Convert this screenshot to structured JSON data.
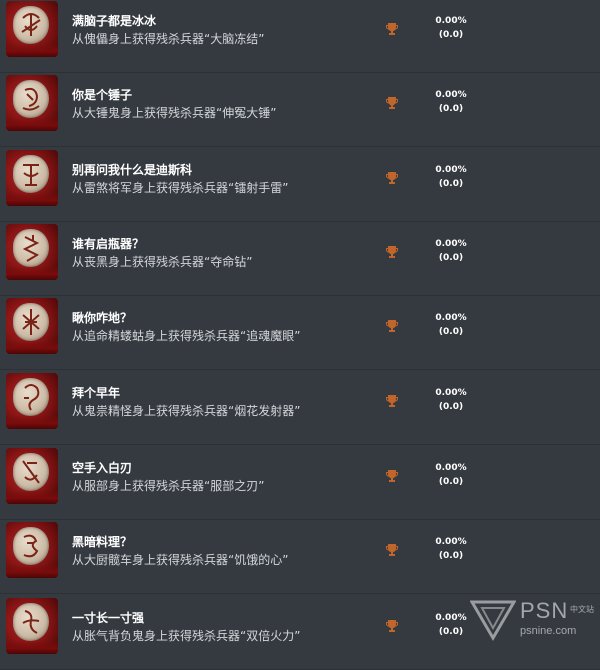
{
  "trophies": [
    {
      "title": "满脑子都是冰冰",
      "description": "从傀儡身上获得残杀兵器“大脑冻结”",
      "percent": "0.00%",
      "count": "(0.0)",
      "icon": "trophy-bronze-icon"
    },
    {
      "title": "你是个锤子",
      "description": "从大锤鬼身上获得残杀兵器“伸冤大锤”",
      "percent": "0.00%",
      "count": "(0.0)",
      "icon": "trophy-bronze-icon"
    },
    {
      "title": "别再问我什么是迪斯科",
      "description": "从雷煞将军身上获得残杀兵器“镭射手雷”",
      "percent": "0.00%",
      "count": "(0.0)",
      "icon": "trophy-bronze-icon"
    },
    {
      "title": "谁有启瓶器？",
      "description": "从丧黑身上获得残杀兵器“夺命钻”",
      "percent": "0.00%",
      "count": "(0.0)",
      "icon": "trophy-bronze-icon"
    },
    {
      "title": "瞅你咋地？",
      "description": "从追命精蝼蛄身上获得残杀兵器“追魂魔眼”",
      "percent": "0.00%",
      "count": "(0.0)",
      "icon": "trophy-bronze-icon"
    },
    {
      "title": "拜个早年",
      "description": "从鬼祟精怪身上获得残杀兵器“烟花发射器”",
      "percent": "0.00%",
      "count": "(0.0)",
      "icon": "trophy-bronze-icon"
    },
    {
      "title": "空手入白刃",
      "description": "从服部身上获得残杀兵器“服部之刃”",
      "percent": "0.00%",
      "count": "(0.0)",
      "icon": "trophy-bronze-icon"
    },
    {
      "title": "黑暗料理？",
      "description": "从大厨髋车身上获得残杀兵器“饥饿的心”",
      "percent": "0.00%",
      "count": "(0.0)",
      "icon": "trophy-bronze-icon"
    },
    {
      "title": "一寸长一寸强",
      "description": "从胀气背负鬼身上获得残杀兵器“双倍火力”",
      "percent": "0.00%",
      "count": "(0.0)",
      "icon": "trophy-bronze-icon"
    }
  ],
  "colors": {
    "background": "#353a40",
    "trophy_bronze": "#c0662a",
    "text": "#ffffff"
  },
  "watermark": {
    "brand": "PSN",
    "brand_cn": "中文站",
    "url": "psnine.com"
  }
}
